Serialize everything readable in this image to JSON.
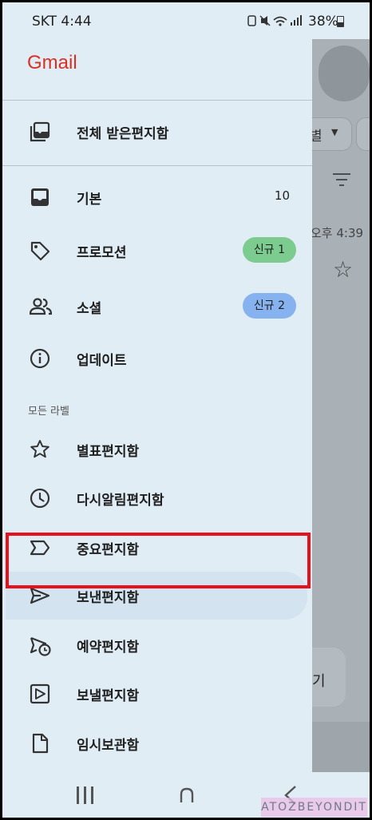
{
  "status_bar": {
    "carrier_time": "SKT 4:44",
    "battery": "38%"
  },
  "drawer": {
    "app_title": "Gmail",
    "all_inboxes": "전체 받은편지함",
    "categories": [
      {
        "label": "기본",
        "icon": "inbox-icon",
        "count": "10"
      },
      {
        "label": "프로모션",
        "icon": "tag-icon",
        "badge": "신규 1",
        "badge_color": "#7ccb8f"
      },
      {
        "label": "소셜",
        "icon": "people-icon",
        "badge": "신규 2",
        "badge_color": "#86b3f0"
      },
      {
        "label": "업데이트",
        "icon": "info-icon"
      }
    ],
    "section_title": "모든 라벨",
    "labels": [
      {
        "label": "별표편지함",
        "icon": "star-icon"
      },
      {
        "label": "다시알림편지함",
        "icon": "clock-icon"
      },
      {
        "label": "중요편지함",
        "icon": "important-icon"
      },
      {
        "label": "보낸편지함",
        "icon": "send-icon",
        "selected": true
      },
      {
        "label": "예약편지함",
        "icon": "scheduled-send-icon"
      },
      {
        "label": "보낼편지함",
        "icon": "outbox-icon"
      },
      {
        "label": "임시보관함",
        "icon": "draft-icon"
      }
    ]
  },
  "background_app": {
    "chip_text": "별",
    "time_text": "오후 4:39",
    "fab_text": "기"
  },
  "watermark": "ATOZBEYONDIT",
  "colors": {
    "accent_red": "#d93025",
    "highlight_red": "#e8101a",
    "drawer_bg": "#e1edf5"
  }
}
